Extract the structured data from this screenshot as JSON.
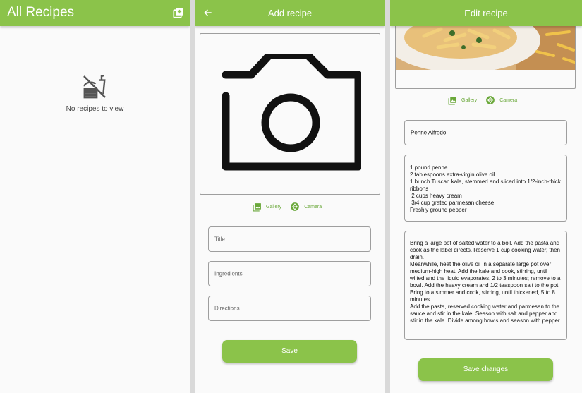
{
  "colors": {
    "accent": "#8bc34a",
    "background": "#fafafa",
    "icon_dark": "#555555"
  },
  "screen1": {
    "title": "All Recipes",
    "add_icon": "add-box-icon",
    "empty_icon": "no-food-icon",
    "empty_text": "No recipes to view"
  },
  "screen2": {
    "title": "Add recipe",
    "back_icon": "arrow-back-icon",
    "camera_icon": "camera-icon",
    "gallery_label": "Gallery",
    "camera_label": "Camera",
    "title_placeholder": "Title",
    "ingredients_placeholder": "Ingredients",
    "directions_placeholder": "Directions",
    "save_label": "Save"
  },
  "screen3": {
    "title": "Edit recipe",
    "gallery_label": "Gallery",
    "camera_label": "Camera",
    "recipe_title": "Penne Alfredo",
    "ingredients": "1 pound penne\n2 tablespoons extra-virgin olive oil\n1 bunch Tuscan kale, stemmed and sliced into 1/2-inch-thick ribbons\n 2 cups heavy cream\n 3/4 cup grated parmesan cheese\nFreshly ground pepper",
    "directions": "Bring a large pot of salted water to a boil. Add the pasta and cook as the label directs. Reserve 1 cup cooking water, then drain.\nMeanwhile, heat the olive oil in a separate large pot over medium-high heat. Add the kale and cook, stirring, until wilted and the liquid evaporates, 2 to 3 minutes; remove to a bowl. Add the heavy cream and 1/2 teaspoon salt to the pot. Bring to a simmer and cook, stirring, until thickened, 5 to 8 minutes.\nAdd the pasta, reserved cooking water and parmesan to the sauce and stir in the kale. Season with salt and pepper and stir in the kale. Divide among bowls and season with pepper.",
    "save_label": "Save changes"
  }
}
